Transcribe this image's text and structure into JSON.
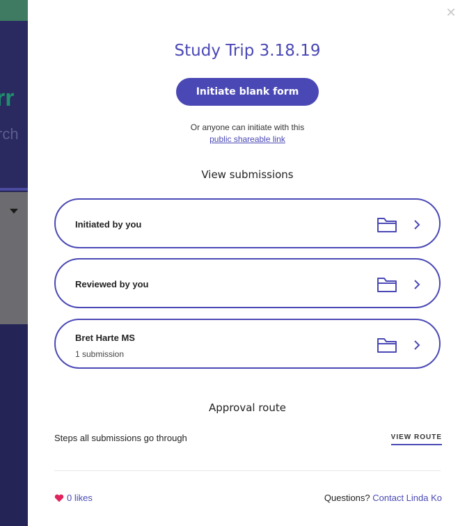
{
  "background": {
    "fragment_text_1": "rr",
    "fragment_text_2": "rch"
  },
  "modal": {
    "title": "Study Trip 3.18.19",
    "close_icon": "close-icon",
    "primary_button": "Initiate blank form",
    "share_text": "Or anyone can initiate with this",
    "share_link": "public shareable link",
    "submissions_heading": "View submissions",
    "submissions": [
      {
        "label": "Initiated by you",
        "count": ""
      },
      {
        "label": "Reviewed by you",
        "count": ""
      },
      {
        "label": "Bret Harte MS",
        "count": "1 submission"
      }
    ],
    "approval_heading": "Approval route",
    "approval_description": "Steps all submissions go through",
    "view_route": "VIEW ROUTE",
    "likes": "0 likes",
    "questions_prefix": "Questions?",
    "contact_link": "Contact Linda Ko"
  },
  "colors": {
    "accent": "#4a48b5",
    "heart": "#e0245e",
    "sidebar": "#252457"
  },
  "icons": [
    "close-icon",
    "folder-icon",
    "chevron-right-icon",
    "heart-icon"
  ]
}
